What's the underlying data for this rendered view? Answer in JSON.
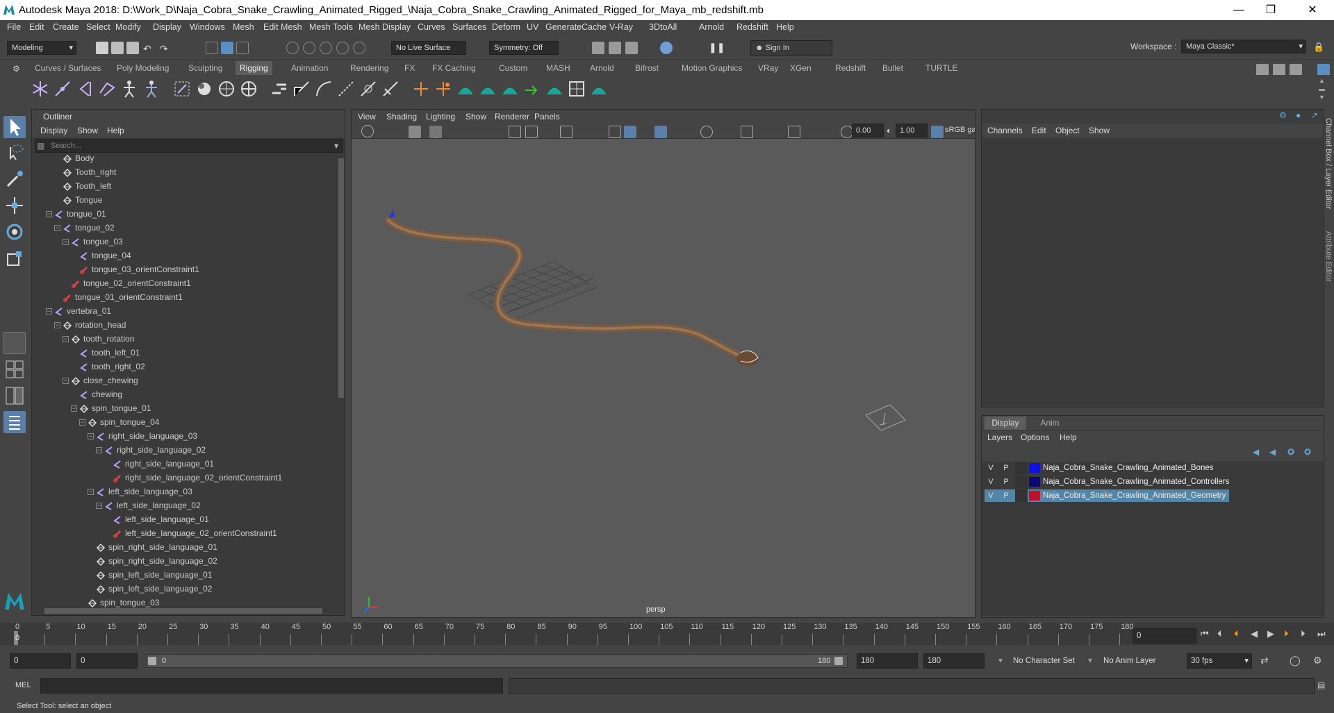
{
  "window": {
    "title": "Autodesk Maya 2018: D:\\Work_D\\Naja_Cobra_Snake_Crawling_Animated_Rigged_\\Naja_Cobra_Snake_Crawling_Animated_Rigged_for_Maya_mb_redshift.mb"
  },
  "menu": [
    "File",
    "Edit",
    "Create",
    "Select",
    "Modify",
    "Display",
    "Windows",
    "Mesh",
    "Edit Mesh",
    "Mesh Tools",
    "Mesh Display",
    "Curves",
    "Surfaces",
    "Deform",
    "UV",
    "Generate",
    "Cache",
    "V-Ray",
    "3DtoAll",
    "Arnold",
    "Redshift",
    "Help"
  ],
  "workspace": {
    "label": "Workspace :",
    "value": "Maya Classic*"
  },
  "statusline": {
    "mode": "Modeling",
    "live_surface": "No Live Surface",
    "symmetry": "Symmetry: Off",
    "sign_in": "Sign In"
  },
  "shelf_tabs": [
    "Curves / Surfaces",
    "Poly Modeling",
    "Sculpting",
    "Rigging",
    "Animation",
    "Rendering",
    "FX",
    "FX Caching",
    "Custom",
    "MASH",
    "Arnold",
    "Bifrost",
    "Motion Graphics",
    "VRay",
    "XGen",
    "Redshift",
    "Bullet",
    "TURTLE"
  ],
  "active_shelf_tab": "Rigging",
  "outliner": {
    "title": "Outliner",
    "menu": [
      "Display",
      "Show",
      "Help"
    ],
    "search_placeholder": "Search...",
    "items": [
      {
        "label": "Body",
        "type": "mesh",
        "depth": 2
      },
      {
        "label": "Tooth_right",
        "type": "mesh",
        "depth": 2
      },
      {
        "label": "Tooth_left",
        "type": "mesh",
        "depth": 2
      },
      {
        "label": "Tongue",
        "type": "mesh",
        "depth": 2
      },
      {
        "label": "tongue_01",
        "type": "joint",
        "depth": 1,
        "expand": true
      },
      {
        "label": "tongue_02",
        "type": "joint",
        "depth": 2,
        "expand": true
      },
      {
        "label": "tongue_03",
        "type": "joint",
        "depth": 3,
        "expand": true
      },
      {
        "label": "tongue_04",
        "type": "joint",
        "depth": 4
      },
      {
        "label": "tongue_03_orientConstraint1",
        "type": "constraint",
        "depth": 4
      },
      {
        "label": "tongue_02_orientConstraint1",
        "type": "constraint",
        "depth": 3
      },
      {
        "label": "tongue_01_orientConstraint1",
        "type": "constraint",
        "depth": 2
      },
      {
        "label": "vertebra_01",
        "type": "joint",
        "depth": 1,
        "expand": true
      },
      {
        "label": "rotation_head",
        "type": "group",
        "depth": 2,
        "expand": true
      },
      {
        "label": "tooth_rotation",
        "type": "group",
        "depth": 3,
        "expand": true
      },
      {
        "label": "tooth_left_01",
        "type": "joint",
        "depth": 4
      },
      {
        "label": "tooth_right_02",
        "type": "joint",
        "depth": 4
      },
      {
        "label": "close_chewing",
        "type": "group",
        "depth": 3,
        "expand": true
      },
      {
        "label": "chewing",
        "type": "joint",
        "depth": 4
      },
      {
        "label": "spin_tongue_01",
        "type": "group",
        "depth": 4,
        "expand": true
      },
      {
        "label": "spin_tongue_04",
        "type": "group",
        "depth": 5,
        "expand": true
      },
      {
        "label": "right_side_language_03",
        "type": "joint",
        "depth": 6,
        "expand": true
      },
      {
        "label": "right_side_language_02",
        "type": "joint",
        "depth": 7,
        "expand": true
      },
      {
        "label": "right_side_language_01",
        "type": "joint",
        "depth": 8
      },
      {
        "label": "right_side_language_02_orientConstraint1",
        "type": "constraint",
        "depth": 8
      },
      {
        "label": "left_side_language_03",
        "type": "joint",
        "depth": 6,
        "expand": true
      },
      {
        "label": "left_side_language_02",
        "type": "joint",
        "depth": 7,
        "expand": true
      },
      {
        "label": "left_side_language_01",
        "type": "joint",
        "depth": 8
      },
      {
        "label": "left_side_language_02_orientConstraint1",
        "type": "constraint",
        "depth": 8
      },
      {
        "label": "spin_right_side_language_01",
        "type": "group",
        "depth": 6
      },
      {
        "label": "spin_right_side_language_02",
        "type": "group",
        "depth": 6
      },
      {
        "label": "spin_left_side_language_01",
        "type": "group",
        "depth": 6
      },
      {
        "label": "spin_left_side_language_02",
        "type": "group",
        "depth": 6
      },
      {
        "label": "spin_tongue_03",
        "type": "group",
        "depth": 5
      }
    ]
  },
  "viewport": {
    "menu": [
      "View",
      "Shading",
      "Lighting",
      "Show",
      "Renderer",
      "Panels"
    ],
    "field_a": "0.00",
    "field_b": "1.00",
    "colorspace": "sRGB gamma",
    "camera": "persp"
  },
  "channel_box": {
    "menu": [
      "Channels",
      "Edit",
      "Object",
      "Show"
    ],
    "side_tabs": [
      "Channel Box / Layer Editor",
      "Attribute Editor"
    ]
  },
  "layer_editor": {
    "tabs": [
      "Display",
      "Anim"
    ],
    "menu": [
      "Layers",
      "Options",
      "Help"
    ],
    "layers": [
      {
        "v": "V",
        "p": "P",
        "name": "Naja_Cobra_Snake_Crawling_Animated_Bones",
        "color": "#1010e0",
        "selected": false
      },
      {
        "v": "V",
        "p": "P",
        "name": "Naja_Cobra_Snake_Crawling_Animated_Controllers",
        "color": "#0a0a70",
        "selected": false
      },
      {
        "v": "V",
        "p": "P",
        "name": "Naja_Cobra_Snake_Crawling_Animated_Geometry",
        "color": "#c01030",
        "selected": true
      }
    ]
  },
  "timeline": {
    "ticks": [
      "0",
      "5",
      "10",
      "15",
      "20",
      "25",
      "30",
      "35",
      "40",
      "45",
      "50",
      "55",
      "60",
      "65",
      "70",
      "75",
      "80",
      "85",
      "90",
      "95",
      "100",
      "105",
      "110",
      "115",
      "120",
      "125",
      "130",
      "135",
      "140",
      "145",
      "150",
      "155",
      "160",
      "165",
      "170",
      "175",
      "180"
    ],
    "current_frame": "0",
    "current_frame_marker": "0"
  },
  "range": {
    "start": "0",
    "playback_start": "0",
    "slider_start": "0",
    "slider_end": "180",
    "playback_end": "180",
    "end": "180",
    "character_set": "No Character Set",
    "anim_layer": "No Anim Layer",
    "fps": "30 fps"
  },
  "cmdline": {
    "label": "MEL"
  },
  "helpline": {
    "text": "Select Tool: select an object"
  }
}
